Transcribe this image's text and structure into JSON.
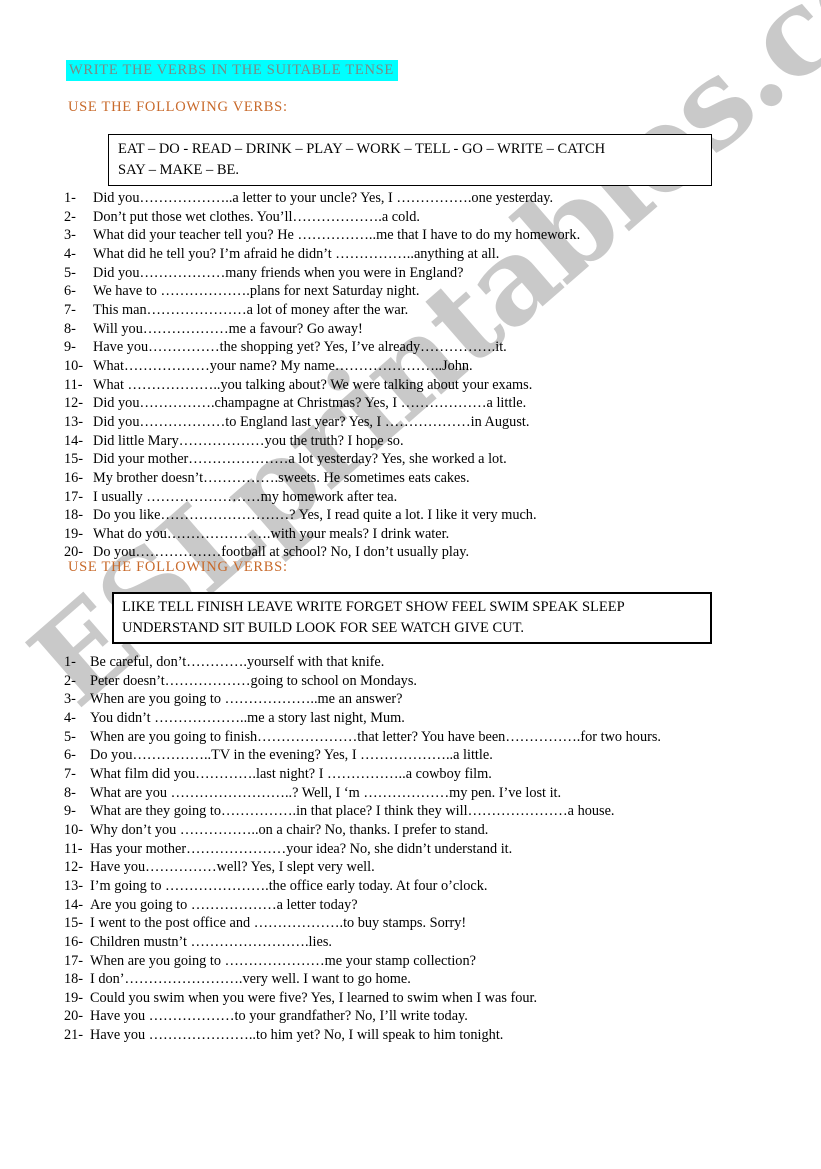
{
  "document": {
    "title": "WRITE THE VERBS IN THE SUITABLE TENSE",
    "watermark": "ESLprintables.com",
    "colors": {
      "title_highlight": "#00ffff",
      "title_text": "#7a8a84",
      "section_header": "#c8692a",
      "watermark": "#c9c9c9",
      "body_text": "#000000",
      "page_background": "#ffffff"
    }
  },
  "sections": [
    {
      "header": "USE THE FOLLOWING VERBS:",
      "verb_box": {
        "lines": [
          "EAT – DO - READ – DRINK – PLAY – WORK – TELL -  GO – WRITE – CATCH",
          "SAY – MAKE – BE."
        ]
      },
      "questions": [
        {
          "number": "1-",
          "text": "Did you………………..a letter to your uncle? Yes, I …………….one yesterday."
        },
        {
          "number": "2-",
          "text": "Don’t put those wet clothes. You’ll……………….a cold."
        },
        {
          "number": "3-",
          "text": "What did your teacher tell you? He ……………..me that I have to do my homework."
        },
        {
          "number": "4-",
          "text": "What did he tell you? I’m afraid he didn’t ……………..anything at all."
        },
        {
          "number": "5-",
          "text": "Did you………………many friends when you were in England?"
        },
        {
          "number": "6-",
          "text": "We have to ……………….plans for next Saturday night."
        },
        {
          "number": "7-",
          "text": "This man…………………a lot of money after the war."
        },
        {
          "number": "8-",
          "text": "Will you………………me a favour? Go away!"
        },
        {
          "number": "9-",
          "text": "Have you……………the shopping yet? Yes, I’ve already…………….it."
        },
        {
          "number": "10-",
          "text": "What………………your name? My name…………………..John."
        },
        {
          "number": "11-",
          "text": "What ………………..you talking about? We were talking about your exams."
        },
        {
          "number": "12-",
          "text": "Did you…………….champagne at Christmas? Yes, I ………………a little."
        },
        {
          "number": "13-",
          "text": "Did you………………to England last year? Yes, I ………………in August."
        },
        {
          "number": "14-",
          "text": "Did little Mary………………you the truth? I hope so."
        },
        {
          "number": "15-",
          "text": "Did your mother…………………a lot yesterday? Yes, she worked a lot."
        },
        {
          "number": "16-",
          "text": "My brother doesn’t…………….sweets. He sometimes eats cakes."
        },
        {
          "number": "17-",
          "text": "I usually ……………………my homework after tea."
        },
        {
          "number": "18-",
          "text": "Do you like………………………? Yes, I read quite a lot. I like it very much."
        },
        {
          "number": "19-",
          "text": "What do you………………….with your meals? I drink water."
        },
        {
          "number": "20-",
          "text": "Do you………………football at school? No, I don’t usually play."
        }
      ]
    },
    {
      "header": "USE THE FOLLOWING VERBS:",
      "verb_box": {
        "lines": [
          "LIKE TELL FINISH LEAVE WRITE FORGET SHOW FEEL SWIM SPEAK SLEEP",
          "UNDERSTAND SIT BUILD LOOK FOR SEE WATCH GIVE CUT."
        ]
      },
      "questions": [
        {
          "number": "1-",
          "text": "Be careful, don’t………….yourself with that knife."
        },
        {
          "number": "2-",
          "text": "Peter doesn’t………………going to school on Mondays."
        },
        {
          "number": "3-",
          "text": "When are you going to ………………..me an answer?"
        },
        {
          "number": "4-",
          "text": "You didn’t ………………..me a story last night, Mum."
        },
        {
          "number": "5-",
          "text": "When are you going to finish…………………that letter? You have been…………….for two hours."
        },
        {
          "number": "6-",
          "text": "Do you……………..TV in the evening? Yes, I ………………..a little."
        },
        {
          "number": "7-",
          "text": "What film did you………….last night? I ……………..a cowboy film."
        },
        {
          "number": "8-",
          "text": "What are you ……………………..? Well, I ‘m ………………my pen. I’ve lost it."
        },
        {
          "number": "9-",
          "text": "What are they going to…………….in that place? I think they will…………………a house."
        },
        {
          "number": "10-",
          "text": "Why don’t you ……………..on a chair? No, thanks. I prefer to stand."
        },
        {
          "number": "11-",
          "text": "Has your mother…………………your idea? No, she didn’t understand it."
        },
        {
          "number": "12-",
          "text": "Have you……………well? Yes, I slept very well."
        },
        {
          "number": "13-",
          "text": "I’m going to ………………….the office early today.  At four o’clock."
        },
        {
          "number": "14-",
          "text": "Are you going to ………………a letter today?"
        },
        {
          "number": "15-",
          "text": "I went to the post office and ……………….to buy stamps. Sorry!"
        },
        {
          "number": "16-",
          "text": "Children mustn’t …………………….lies."
        },
        {
          "number": "17-",
          "text": "When are you going to …………………me your stamp collection?"
        },
        {
          "number": "18-",
          "text": "I don’…………………….very well. I want to go home."
        },
        {
          "number": "19-",
          "text": "Could you swim when you were five?  Yes, I learned to swim when I was four."
        },
        {
          "number": "20-",
          "text": "Have you ………………to your grandfather? No, I’ll write today."
        },
        {
          "number": "21-",
          "text": "Have you …………………..to him yet? No, I will speak to him tonight."
        }
      ]
    }
  ]
}
